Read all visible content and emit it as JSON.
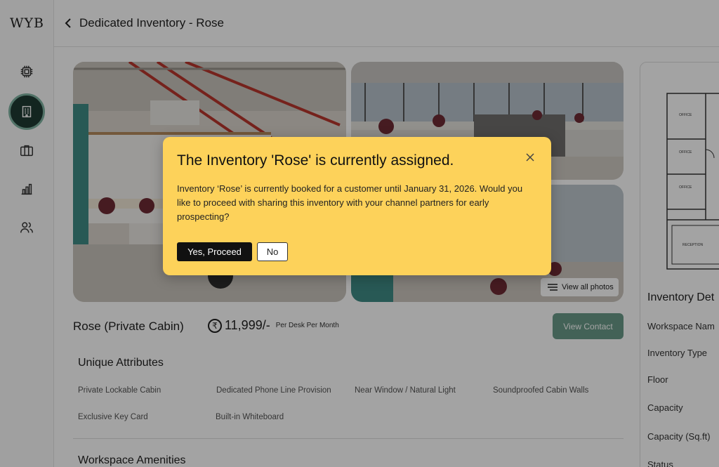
{
  "app": {
    "logo": "WYB"
  },
  "sidebar": {
    "items": [
      {
        "name": "chip-icon"
      },
      {
        "name": "building-icon",
        "active": true
      },
      {
        "name": "briefcase-icon"
      },
      {
        "name": "bar-chart-icon"
      },
      {
        "name": "users-icon"
      }
    ]
  },
  "header": {
    "title": "Dedicated Inventory - Rose"
  },
  "gallery": {
    "view_all_label": "View all photos"
  },
  "listing": {
    "name": "Rose (Private Cabin)",
    "currency_symbol": "₹",
    "price": "11,999/-",
    "price_unit": "Per Desk Per Month",
    "view_contact_label": "View Contact"
  },
  "unique_attributes": {
    "title": "Unique Attributes",
    "items": [
      "Private Lockable Cabin",
      "Dedicated Phone Line Provision",
      "Near Window / Natural Light",
      "Soundproofed Cabin Walls",
      "Exclusive Key Card",
      "Built-in Whiteboard"
    ]
  },
  "amenities": {
    "title": "Workspace Amenities"
  },
  "details_panel": {
    "title": "Inventory Det",
    "labels": [
      "Workspace Nam",
      "Inventory Type",
      "Floor",
      "Capacity",
      "Capacity (Sq.ft)",
      "Status"
    ],
    "plan_rooms": [
      "OFFICE",
      "OFFICE",
      "OFFICE",
      "RECEPTION"
    ]
  },
  "modal": {
    "title": "The Inventory 'Rose' is currently assigned.",
    "body": "Inventory ‘Rose’ is currently booked for a customer until January 31, 2026. Would you like to proceed with sharing this inventory with your channel partners for early prospecting?",
    "yes_label": "Yes, Proceed",
    "no_label": "No"
  },
  "colors": {
    "modal_bg": "#fdd25a",
    "primary_button": "#111111",
    "view_contact_button": "#6a9a89",
    "sidebar_active": "#1f3a33"
  }
}
